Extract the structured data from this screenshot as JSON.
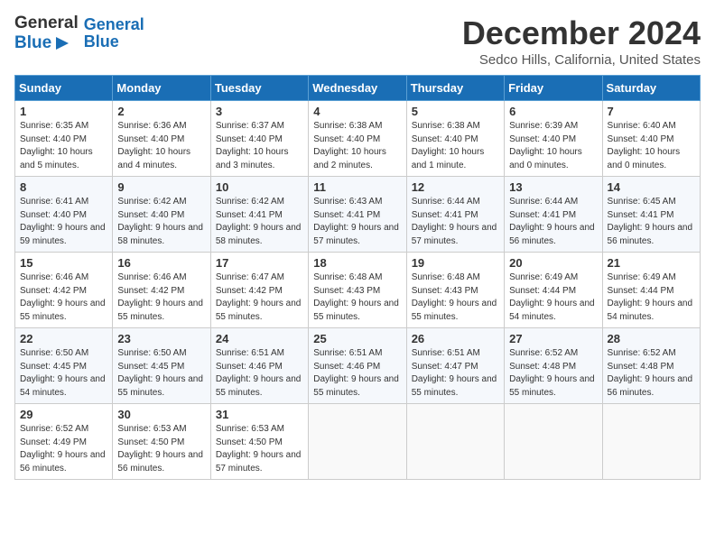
{
  "header": {
    "logo_line1": "General",
    "logo_line2": "Blue",
    "title": "December 2024",
    "subtitle": "Sedco Hills, California, United States"
  },
  "days_of_week": [
    "Sunday",
    "Monday",
    "Tuesday",
    "Wednesday",
    "Thursday",
    "Friday",
    "Saturday"
  ],
  "weeks": [
    [
      {
        "day": "1",
        "sunrise": "6:35 AM",
        "sunset": "4:40 PM",
        "daylight": "10 hours and 5 minutes."
      },
      {
        "day": "2",
        "sunrise": "6:36 AM",
        "sunset": "4:40 PM",
        "daylight": "10 hours and 4 minutes."
      },
      {
        "day": "3",
        "sunrise": "6:37 AM",
        "sunset": "4:40 PM",
        "daylight": "10 hours and 3 minutes."
      },
      {
        "day": "4",
        "sunrise": "6:38 AM",
        "sunset": "4:40 PM",
        "daylight": "10 hours and 2 minutes."
      },
      {
        "day": "5",
        "sunrise": "6:38 AM",
        "sunset": "4:40 PM",
        "daylight": "10 hours and 1 minute."
      },
      {
        "day": "6",
        "sunrise": "6:39 AM",
        "sunset": "4:40 PM",
        "daylight": "10 hours and 0 minutes."
      },
      {
        "day": "7",
        "sunrise": "6:40 AM",
        "sunset": "4:40 PM",
        "daylight": "10 hours and 0 minutes."
      }
    ],
    [
      {
        "day": "8",
        "sunrise": "6:41 AM",
        "sunset": "4:40 PM",
        "daylight": "9 hours and 59 minutes."
      },
      {
        "day": "9",
        "sunrise": "6:42 AM",
        "sunset": "4:40 PM",
        "daylight": "9 hours and 58 minutes."
      },
      {
        "day": "10",
        "sunrise": "6:42 AM",
        "sunset": "4:41 PM",
        "daylight": "9 hours and 58 minutes."
      },
      {
        "day": "11",
        "sunrise": "6:43 AM",
        "sunset": "4:41 PM",
        "daylight": "9 hours and 57 minutes."
      },
      {
        "day": "12",
        "sunrise": "6:44 AM",
        "sunset": "4:41 PM",
        "daylight": "9 hours and 57 minutes."
      },
      {
        "day": "13",
        "sunrise": "6:44 AM",
        "sunset": "4:41 PM",
        "daylight": "9 hours and 56 minutes."
      },
      {
        "day": "14",
        "sunrise": "6:45 AM",
        "sunset": "4:41 PM",
        "daylight": "9 hours and 56 minutes."
      }
    ],
    [
      {
        "day": "15",
        "sunrise": "6:46 AM",
        "sunset": "4:42 PM",
        "daylight": "9 hours and 55 minutes."
      },
      {
        "day": "16",
        "sunrise": "6:46 AM",
        "sunset": "4:42 PM",
        "daylight": "9 hours and 55 minutes."
      },
      {
        "day": "17",
        "sunrise": "6:47 AM",
        "sunset": "4:42 PM",
        "daylight": "9 hours and 55 minutes."
      },
      {
        "day": "18",
        "sunrise": "6:48 AM",
        "sunset": "4:43 PM",
        "daylight": "9 hours and 55 minutes."
      },
      {
        "day": "19",
        "sunrise": "6:48 AM",
        "sunset": "4:43 PM",
        "daylight": "9 hours and 55 minutes."
      },
      {
        "day": "20",
        "sunrise": "6:49 AM",
        "sunset": "4:44 PM",
        "daylight": "9 hours and 54 minutes."
      },
      {
        "day": "21",
        "sunrise": "6:49 AM",
        "sunset": "4:44 PM",
        "daylight": "9 hours and 54 minutes."
      }
    ],
    [
      {
        "day": "22",
        "sunrise": "6:50 AM",
        "sunset": "4:45 PM",
        "daylight": "9 hours and 54 minutes."
      },
      {
        "day": "23",
        "sunrise": "6:50 AM",
        "sunset": "4:45 PM",
        "daylight": "9 hours and 55 minutes."
      },
      {
        "day": "24",
        "sunrise": "6:51 AM",
        "sunset": "4:46 PM",
        "daylight": "9 hours and 55 minutes."
      },
      {
        "day": "25",
        "sunrise": "6:51 AM",
        "sunset": "4:46 PM",
        "daylight": "9 hours and 55 minutes."
      },
      {
        "day": "26",
        "sunrise": "6:51 AM",
        "sunset": "4:47 PM",
        "daylight": "9 hours and 55 minutes."
      },
      {
        "day": "27",
        "sunrise": "6:52 AM",
        "sunset": "4:48 PM",
        "daylight": "9 hours and 55 minutes."
      },
      {
        "day": "28",
        "sunrise": "6:52 AM",
        "sunset": "4:48 PM",
        "daylight": "9 hours and 56 minutes."
      }
    ],
    [
      {
        "day": "29",
        "sunrise": "6:52 AM",
        "sunset": "4:49 PM",
        "daylight": "9 hours and 56 minutes."
      },
      {
        "day": "30",
        "sunrise": "6:53 AM",
        "sunset": "4:50 PM",
        "daylight": "9 hours and 56 minutes."
      },
      {
        "day": "31",
        "sunrise": "6:53 AM",
        "sunset": "4:50 PM",
        "daylight": "9 hours and 57 minutes."
      },
      null,
      null,
      null,
      null
    ]
  ],
  "labels": {
    "sunrise": "Sunrise:",
    "sunset": "Sunset:",
    "daylight": "Daylight:"
  }
}
